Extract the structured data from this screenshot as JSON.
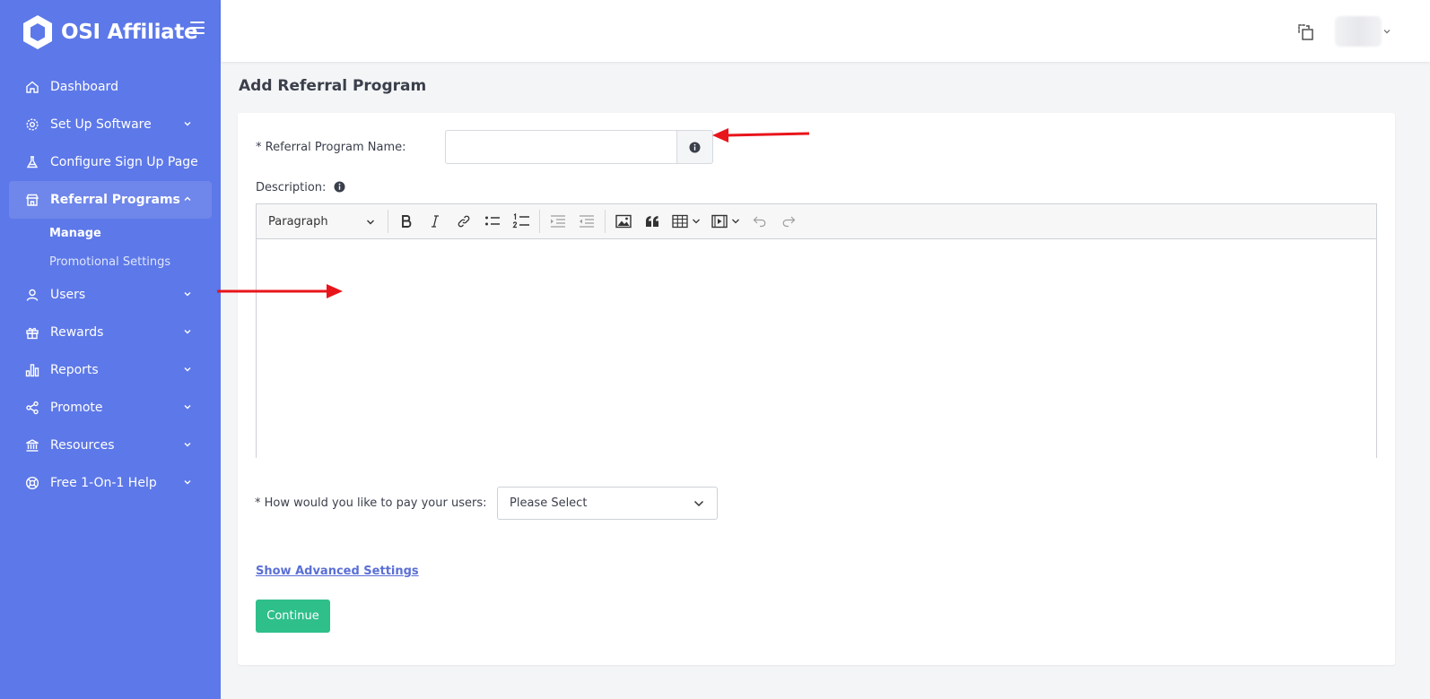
{
  "sidebar": {
    "brand": "OSI Affiliate",
    "items": [
      {
        "label": "Dashboard"
      },
      {
        "label": "Set Up Software"
      },
      {
        "label": "Configure Sign Up Page"
      },
      {
        "label": "Referral Programs"
      },
      {
        "label": "Users"
      },
      {
        "label": "Rewards"
      },
      {
        "label": "Reports"
      },
      {
        "label": "Promote"
      },
      {
        "label": "Resources"
      },
      {
        "label": "Free 1-On-1 Help"
      }
    ],
    "sub_items": [
      {
        "label": "Manage"
      },
      {
        "label": "Promotional Settings"
      }
    ]
  },
  "page": {
    "title": "Add Referral Program"
  },
  "form": {
    "name_label": "* Referral Program Name:",
    "name_value": "",
    "description_label": "Description:",
    "editor": {
      "block_format": "Paragraph"
    },
    "pay_label": "* How would you like to pay your users:",
    "pay_value": "Please Select",
    "advanced_link": "Show Advanced Settings",
    "continue_label": "Continue"
  },
  "colors": {
    "sidebar_bg": "#5d78e8",
    "active_item_bg": "#6f86ea",
    "continue_bg": "#2fbf8b",
    "link": "#5a6fd6",
    "annotation_arrow": "#e8151b"
  }
}
